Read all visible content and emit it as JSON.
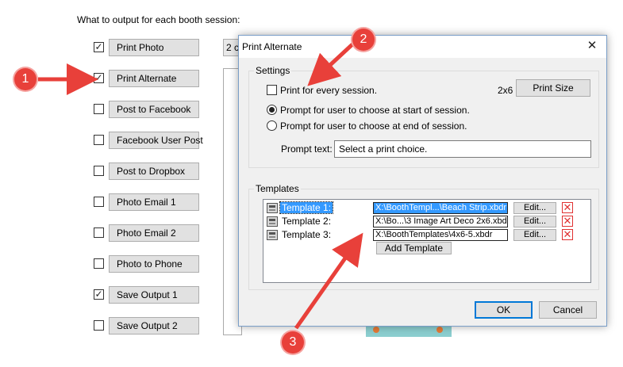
{
  "heading": "What to output for each booth session:",
  "outputs": [
    {
      "label": "Print Photo",
      "checked": true
    },
    {
      "label": "Print Alternate",
      "checked": true
    },
    {
      "label": "Post to Facebook",
      "checked": false
    },
    {
      "label": "Facebook User Post",
      "checked": false
    },
    {
      "label": "Post to Dropbox",
      "checked": false
    },
    {
      "label": "Photo Email 1",
      "checked": false
    },
    {
      "label": "Photo Email 2",
      "checked": false
    },
    {
      "label": "Photo to Phone",
      "checked": false
    },
    {
      "label": "Save Output 1",
      "checked": true
    },
    {
      "label": "Save Output 2",
      "checked": false
    }
  ],
  "background_dropdown": "2 c",
  "check_mark": "✓",
  "dialog": {
    "title": "Print Alternate",
    "close_glyph": "✕",
    "settings": {
      "group_label": "Settings",
      "print_every_session": "Print for every session.",
      "print_every_session_checked": false,
      "size_label": "2x6",
      "print_size_button": "Print Size",
      "radio_start": "Prompt for user to choose at start of session.",
      "radio_end": "Prompt for user to choose at end of session.",
      "selected_radio": "start",
      "prompt_text_label": "Prompt text:",
      "prompt_text_value": "Select a print choice."
    },
    "templates": {
      "group_label": "Templates",
      "items": [
        {
          "name": "Template 1:",
          "path": "X:\\BoothTempl...\\Beach Strip.xbdr",
          "edit": "Edit...",
          "selected": true
        },
        {
          "name": "Template 2:",
          "path": "X:\\Bo...\\3 Image Art Deco 2x6.xbdr",
          "edit": "Edit...",
          "selected": false
        },
        {
          "name": "Template 3:",
          "path": "X:\\BoothTemplates\\4x6-5.xbdr",
          "edit": "Edit...",
          "selected": false
        }
      ],
      "delete_glyph": "✕",
      "add_button": "Add Template"
    },
    "ok_button": "OK",
    "cancel_button": "Cancel"
  },
  "callouts": [
    "1",
    "2",
    "3"
  ],
  "colors": {
    "callout": "#e8403a",
    "selection": "#3399ff",
    "dialog_border": "#7a9ec8",
    "delete_red": "#e03030"
  }
}
